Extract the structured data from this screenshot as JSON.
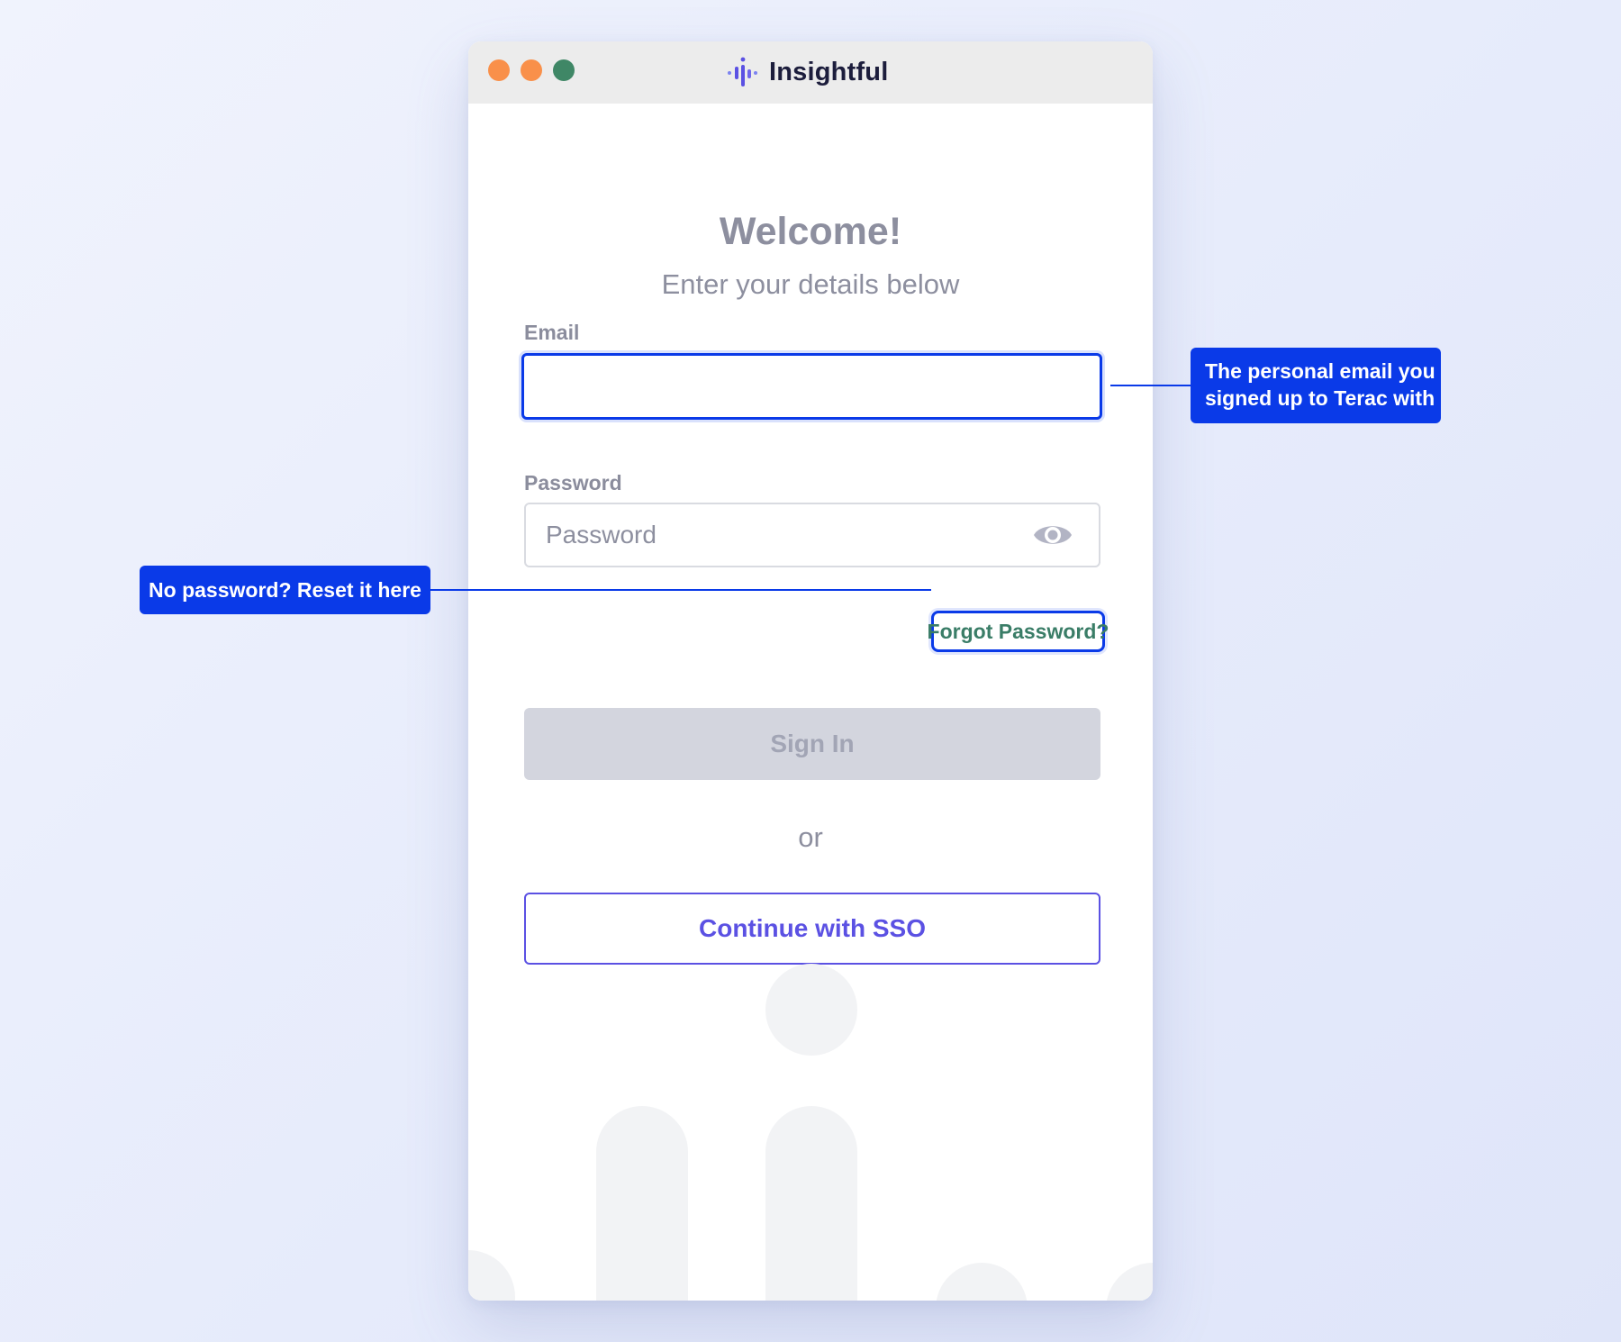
{
  "window": {
    "brand_name": "Insightful",
    "brand_color": "#5b51e3",
    "traffic_lights": [
      "#f9904a",
      "#f9904a",
      "#3f8766"
    ]
  },
  "login": {
    "title": "Welcome!",
    "subtitle": "Enter your details below",
    "email_label": "Email",
    "email_value": "",
    "password_label": "Password",
    "password_placeholder": "Password",
    "show_password_icon": "eye-icon",
    "forgot_password_label": "Forgot Password?",
    "sign_in_label": "Sign In",
    "or_label": "or",
    "sso_label": "Continue with SSO"
  },
  "annotations": {
    "email_note": [
      "The personal email you",
      "signed up to Terac with"
    ],
    "forgot_note": "No password? Reset it here",
    "highlight_color": "#0a3ae8"
  }
}
